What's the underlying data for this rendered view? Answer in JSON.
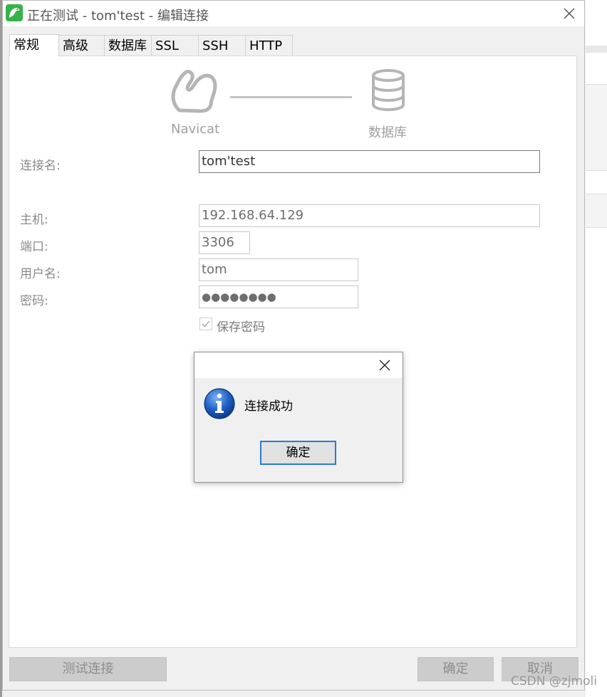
{
  "window": {
    "title": "正在测试 - tom'test - 编辑连接"
  },
  "tabs": [
    {
      "label": "常规",
      "active": true
    },
    {
      "label": "高级",
      "active": false
    },
    {
      "label": "数据库",
      "active": false
    },
    {
      "label": "SSL",
      "active": false
    },
    {
      "label": "SSH",
      "active": false
    },
    {
      "label": "HTTP",
      "active": false
    }
  ],
  "diagram": {
    "left_label": "Navicat",
    "right_label": "数据库",
    "left_icon": "navicat-logo-icon",
    "right_icon": "database-icon"
  },
  "form": {
    "connection_name_label": "连接名:",
    "connection_name_value": "tom'test",
    "host_label": "主机:",
    "host_value": "192.168.64.129",
    "port_label": "端口:",
    "port_value": "3306",
    "username_label": "用户名:",
    "username_value": "tom",
    "password_label": "密码:",
    "password_value": "●●●●●●●●",
    "save_password_label": "保存密码",
    "save_password_checked": true
  },
  "footer": {
    "test_connection_label": "测试连接",
    "ok_label": "确定",
    "cancel_label": "取消"
  },
  "dialog": {
    "message": "连接成功",
    "ok_label": "确定",
    "icon": "info-icon"
  },
  "watermark": "CSDN @zjmoli",
  "colors": {
    "accent": "#2a7ad4",
    "app_icon": "#35b34a",
    "info_icon": "#1f5fc4"
  }
}
